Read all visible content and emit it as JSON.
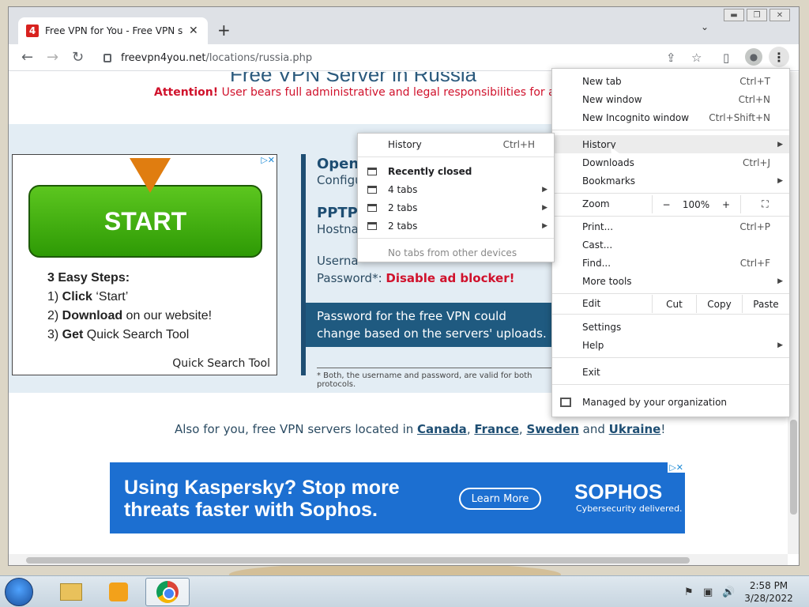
{
  "browser": {
    "tab_title": "Free VPN for You - Free VPN serv",
    "favicon_text": "4",
    "url_host": "freevpn4you.net",
    "url_path": "/locations/russia.php"
  },
  "page": {
    "heading_partial": "Free VPN Server in Russia",
    "attention_label": "Attention!",
    "attention_text": " User bears full administrative and legal responsibilities for any misus",
    "ad1": {
      "start_label": "START",
      "steps_title": "3 Easy Steps:",
      "step1_bold": "Click",
      "step1_rest": " ‘Start’",
      "step2_bold": "Download",
      "step2_rest": " on our website!",
      "step3_bold": "Get",
      "step3_rest": " Quick Search Tool",
      "footer": "Quick Search Tool"
    },
    "vpn": {
      "openvpn_heading": "OpenV",
      "openvpn_sub": "Configu",
      "pptp_heading": "PPTP",
      "pptp_sub": "Hostna",
      "username_label": "Userna",
      "password_label": "Password*:",
      "password_value": "Disable ad blocker!",
      "notice": "Password for the free VPN could change based on the servers' uploads.",
      "footnote": "* Both, the username and password, are valid for both protocols."
    },
    "also_prefix": "Also for you, free VPN servers located in ",
    "also_links": [
      "Canada",
      "France",
      "Sweden",
      "Ukraine"
    ],
    "ad2": {
      "headline_line1": "Using Kaspersky? Stop more",
      "headline_line2": "threats faster with Sophos.",
      "cta": "Learn More",
      "brand": "SOPHOS",
      "tagline": "Cybersecurity delivered."
    }
  },
  "main_menu": {
    "new_tab": {
      "label": "New tab",
      "shortcut": "Ctrl+T"
    },
    "new_window": {
      "label": "New window",
      "shortcut": "Ctrl+N"
    },
    "incognito": {
      "label": "New Incognito window",
      "shortcut": "Ctrl+Shift+N"
    },
    "history": {
      "label": "History"
    },
    "downloads": {
      "label": "Downloads",
      "shortcut": "Ctrl+J"
    },
    "bookmarks": {
      "label": "Bookmarks"
    },
    "zoom": {
      "label": "Zoom",
      "minus": "−",
      "value": "100%",
      "plus": "+"
    },
    "print": {
      "label": "Print...",
      "shortcut": "Ctrl+P"
    },
    "cast": {
      "label": "Cast..."
    },
    "find": {
      "label": "Find...",
      "shortcut": "Ctrl+F"
    },
    "more_tools": {
      "label": "More tools"
    },
    "edit": {
      "label": "Edit",
      "cut": "Cut",
      "copy": "Copy",
      "paste": "Paste"
    },
    "settings": {
      "label": "Settings"
    },
    "help": {
      "label": "Help"
    },
    "exit": {
      "label": "Exit"
    },
    "managed": {
      "label": "Managed by your organization"
    }
  },
  "history_menu": {
    "history": {
      "label": "History",
      "shortcut": "Ctrl+H"
    },
    "recently_closed": "Recently closed",
    "items": [
      "4 tabs",
      "2 tabs",
      "2 tabs"
    ],
    "no_tabs": "No tabs from other devices"
  },
  "taskbar": {
    "time": "2:58 PM",
    "date": "3/28/2022"
  }
}
